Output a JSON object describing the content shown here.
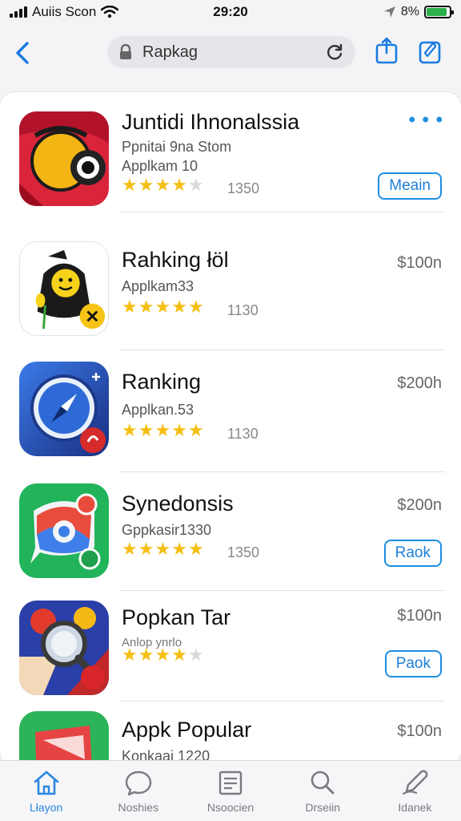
{
  "status_bar": {
    "carrier": "Auiis Scon",
    "time": "29:20",
    "battery": "8%",
    "battery_level": 0.9,
    "colors": {
      "battery": "#2db14a"
    }
  },
  "browser": {
    "address_text": "Rapkag",
    "accent_color": "#1a7be0"
  },
  "apps": [
    {
      "title": "Juntidi Ihnonalssia",
      "subtitle": "Ppnitai 9na Stom",
      "category": "Applkam 10",
      "rating": 4,
      "rating_count": "1350",
      "price": "",
      "action": "Meain",
      "icon": "camera-app-icon"
    },
    {
      "title": "Rahking łöl",
      "subtitle": "",
      "category": "Applkam33",
      "rating": 4.5,
      "rating_count": "1130",
      "price": "$100n",
      "action": "",
      "icon": "character-app-icon"
    },
    {
      "title": "Ranking",
      "subtitle": "",
      "category": "Applkan.53",
      "rating": 5,
      "rating_count": "1130",
      "price": "$200h",
      "action": "",
      "icon": "compass-app-icon"
    },
    {
      "title": "Synedonsis",
      "subtitle": "",
      "category": "Gppkasir1330",
      "rating": 5,
      "rating_count": "1350",
      "price": "$200n",
      "action": "Raok",
      "icon": "chat-app-icon"
    },
    {
      "title": "Popkan Tar",
      "subtitle": "",
      "category": "Anlop ynrlo",
      "rating": 4,
      "rating_count": "",
      "price": "$100n",
      "action": "Paok",
      "icon": "magnifier-app-icon"
    },
    {
      "title": "Appk Popular",
      "subtitle": "",
      "category": "Konkaai 1220",
      "rating": 0,
      "rating_count": "",
      "price": "$100n",
      "action": "",
      "icon": "map-app-icon"
    }
  ],
  "tab_bar": {
    "tabs": [
      {
        "label": "Lłayon",
        "icon": "home-icon",
        "active": true
      },
      {
        "label": "Noshies",
        "icon": "chat-bubble-icon",
        "active": false
      },
      {
        "label": "Nsoocien",
        "icon": "notes-icon",
        "active": false
      },
      {
        "label": "Drseiin",
        "icon": "search-icon",
        "active": false
      },
      {
        "label": "Idanek",
        "icon": "pen-icon",
        "active": false
      }
    ]
  }
}
